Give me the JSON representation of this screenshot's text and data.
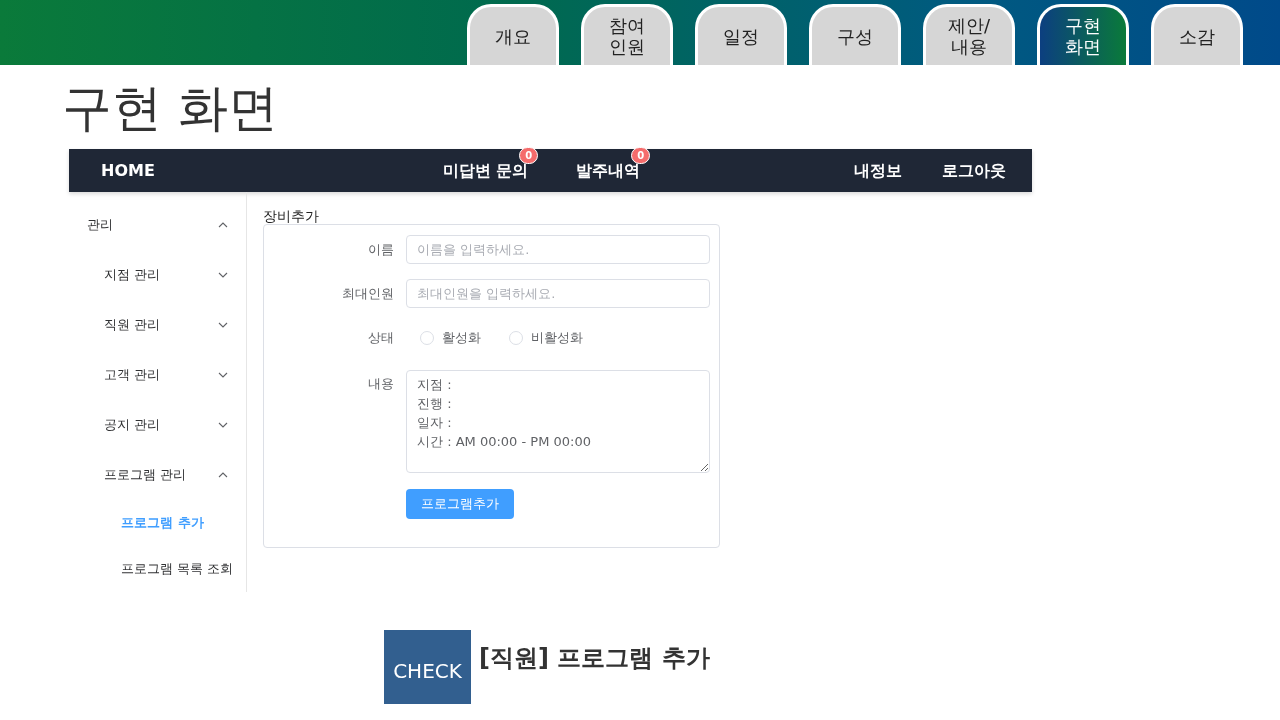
{
  "slide_tabs": [
    {
      "label": "개요",
      "selected": false
    },
    {
      "label": "참여\n인원",
      "selected": false
    },
    {
      "label": "일정",
      "selected": false
    },
    {
      "label": "구성",
      "selected": false
    },
    {
      "label": "제안/\n내용",
      "selected": false
    },
    {
      "label": "구현\n화면",
      "selected": true
    },
    {
      "label": "소감",
      "selected": false
    }
  ],
  "slide_title": "구현 화면",
  "app": {
    "navbar": {
      "home": "HOME",
      "center_links": [
        {
          "label": "미답변 문의",
          "badge": "0"
        },
        {
          "label": "발주내역",
          "badge": "0"
        }
      ],
      "right_links": [
        "내정보",
        "로그아웃"
      ]
    },
    "sidebar": {
      "items": [
        {
          "label": "관리",
          "expanded": true,
          "children": [
            {
              "label": "지점 관리",
              "expanded": false
            },
            {
              "label": "직원 관리",
              "expanded": false
            },
            {
              "label": "고객 관리",
              "expanded": false
            },
            {
              "label": "공지 관리",
              "expanded": false
            },
            {
              "label": "프로그램 관리",
              "expanded": true,
              "children": [
                {
                  "label": "프로그램 추가",
                  "selected": true
                },
                {
                  "label": "프로그램 목록 조회",
                  "selected": false
                }
              ]
            }
          ]
        }
      ]
    },
    "form": {
      "title": "장비추가",
      "fields": [
        {
          "kind": "text",
          "label": "이름",
          "placeholder": "이름을 입력하세요."
        },
        {
          "kind": "text",
          "label": "최대인원",
          "placeholder": "최대인원을 입력하세요."
        },
        {
          "kind": "radio",
          "label": "상태",
          "options": [
            {
              "label": "활성화",
              "selected": false
            },
            {
              "label": "비활성화",
              "selected": false
            }
          ]
        },
        {
          "kind": "textarea",
          "label": "내용",
          "value": "지점 :\n진행 :\n일자 :\n시간 : AM 00:00 - PM 00:00"
        }
      ],
      "submit": "프로그램추가"
    }
  },
  "check": {
    "badge": "CHECK",
    "caption": "[직원] 프로그램 추가"
  }
}
